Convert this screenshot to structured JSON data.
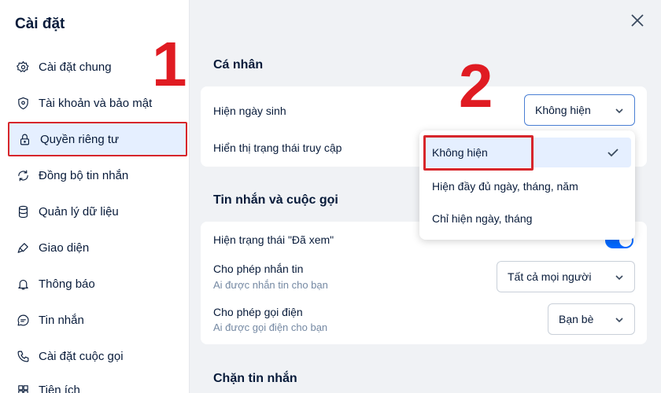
{
  "sidebar": {
    "title": "Cài đặt",
    "items": [
      {
        "label": "Cài đặt chung",
        "icon": "gear-icon"
      },
      {
        "label": "Tài khoản và bảo mật",
        "icon": "shield-icon"
      },
      {
        "label": "Quyền riêng tư",
        "icon": "lock-icon"
      },
      {
        "label": "Đồng bộ tin nhắn",
        "icon": "sync-icon"
      },
      {
        "label": "Quản lý dữ liệu",
        "icon": "database-icon"
      },
      {
        "label": "Giao diện",
        "icon": "brush-icon"
      },
      {
        "label": "Thông báo",
        "icon": "bell-icon"
      },
      {
        "label": "Tin nhắn",
        "icon": "chat-icon"
      },
      {
        "label": "Cài đặt cuộc gọi",
        "icon": "phone-icon"
      },
      {
        "label": "Tiện ích",
        "icon": "grid-icon"
      }
    ],
    "active_index": 2
  },
  "annotations": {
    "step1": "1",
    "step2": "2"
  },
  "personal": {
    "title": "Cá nhân",
    "birthday_label": "Hiện ngày sinh",
    "birthday_value": "Không hiện",
    "access_status_label": "Hiển thị trạng thái truy cập"
  },
  "dropdown": {
    "options": [
      "Không hiện",
      "Hiện đầy đủ ngày, tháng, năm",
      "Chỉ hiện ngày, tháng"
    ],
    "selected_index": 0
  },
  "messages": {
    "title": "Tin nhắn và cuộc gọi",
    "seen_label": "Hiện trạng thái \"Đã xem\"",
    "seen_enabled": true,
    "allow_msg_label": "Cho phép nhắn tin",
    "allow_msg_sub": "Ai được nhắn tin cho bạn",
    "allow_msg_value": "Tất cả mọi người",
    "allow_call_label": "Cho phép gọi điện",
    "allow_call_sub": "Ai được gọi điện cho bạn",
    "allow_call_value": "Bạn bè"
  },
  "block": {
    "title": "Chặn tin nhắn"
  },
  "colors": {
    "accent": "#0068ff",
    "highlight": "#d7262b",
    "selected_bg": "#e5efff"
  }
}
